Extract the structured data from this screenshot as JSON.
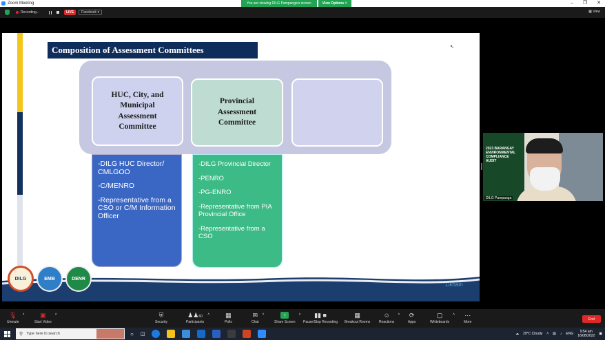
{
  "window": {
    "title": "Zoom Meeting",
    "banner_message": "You are viewing DILG Pampanga's screen",
    "view_options": "View Options ˅"
  },
  "meeting_bar": {
    "recording": "Recording...",
    "live": "LIVE",
    "facebook": "Facebook ▾",
    "view": "View"
  },
  "slide": {
    "title": "Composition of Assessment Committees",
    "committees": [
      {
        "name_lines": [
          "HUC, City, and",
          "Municipal",
          "Assessment",
          "Committee"
        ],
        "members": [
          "-DILG HUC  Director/ CMLGOO",
          "-C/MENRO",
          "-Representative from a CSO or C/M Information Officer"
        ]
      },
      {
        "name_lines": [
          "Provincial",
          "Assessment",
          "Committee"
        ],
        "members": [
          "-DILG Provincial Director",
          "-PENRO",
          "-PG-ENRO",
          "-Representative from PIA Provincial Office",
          "-Representative from a CSO"
        ]
      },
      {
        "name_lines": [],
        "members": []
      }
    ],
    "logos": [
      "DILG",
      "EMB",
      "DENR"
    ],
    "brand": "Likhain"
  },
  "camera": {
    "name": "DILG Pampanga",
    "overlay_lines": [
      "2023 BARANGAY",
      "ENVIRONMENTAL",
      "COMPLIANCE",
      "AUDIT"
    ]
  },
  "toolbar": {
    "items": [
      {
        "label": "Unmute",
        "icon": "mic-muted-icon"
      },
      {
        "label": "Start Video",
        "icon": "video-off-icon"
      },
      {
        "label": "Security",
        "icon": "shield-icon"
      },
      {
        "label": "Participants",
        "count": "60",
        "icon": "participants-icon"
      },
      {
        "label": "Polls",
        "icon": "polls-icon"
      },
      {
        "label": "Chat",
        "icon": "chat-icon"
      },
      {
        "label": "Share Screen",
        "icon": "share-screen-icon"
      },
      {
        "label": "Pause/Stop Recording",
        "icon": "pause-recording-icon"
      },
      {
        "label": "Breakout Rooms",
        "icon": "breakout-icon"
      },
      {
        "label": "Reactions",
        "icon": "reactions-icon"
      },
      {
        "label": "Apps",
        "icon": "apps-icon"
      },
      {
        "label": "Whiteboards",
        "icon": "whiteboard-icon"
      },
      {
        "label": "More",
        "icon": "more-icon"
      }
    ],
    "end": "End"
  },
  "taskbar": {
    "search_placeholder": "Type here to search",
    "weather": "29°C  Cloudy",
    "language": "ENG",
    "time": "9:54 am",
    "date": "16/08/2022"
  }
}
